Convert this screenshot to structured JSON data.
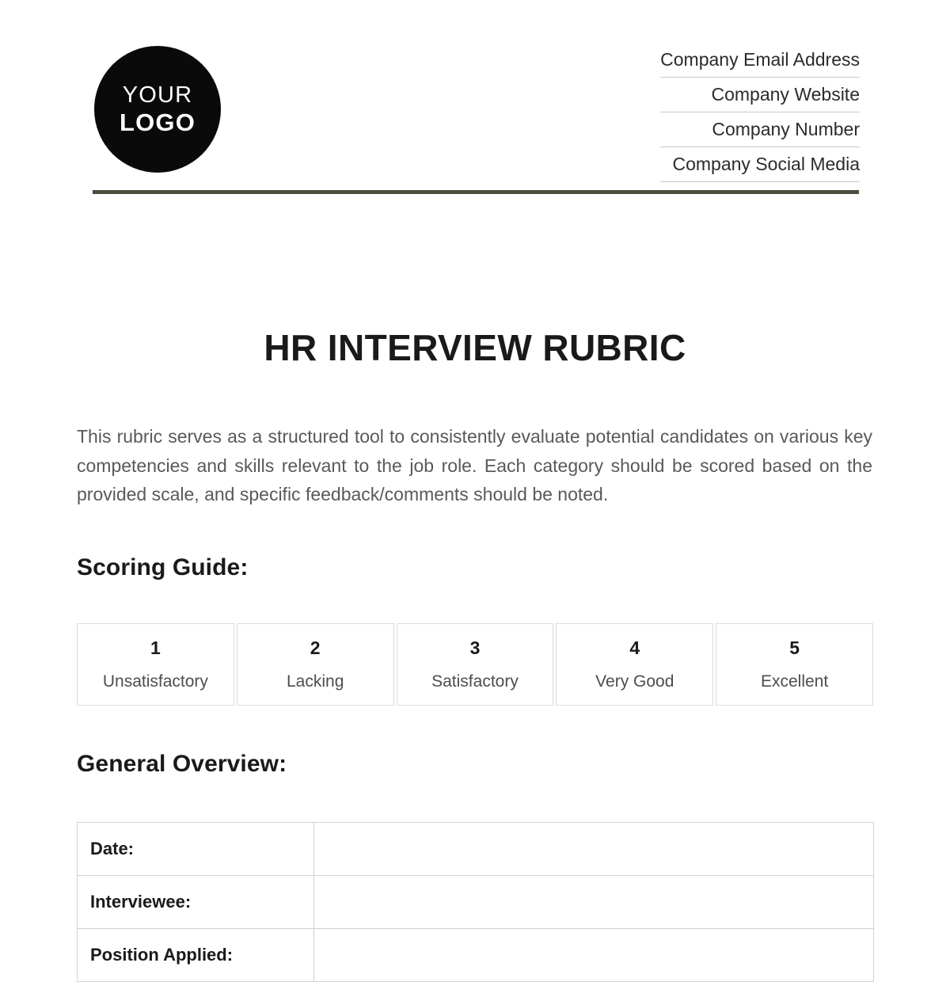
{
  "header": {
    "logo": {
      "line1": "YOUR",
      "line2": "LOGO"
    },
    "contact": [
      {
        "label": "Company Email Address"
      },
      {
        "label": "Company Website"
      },
      {
        "label": "Company Number"
      },
      {
        "label": "Company Social Media"
      }
    ],
    "rule_color": "#4b4b3e"
  },
  "document": {
    "title": "HR INTERVIEW RUBRIC",
    "intro": "This rubric serves as a structured tool to consistently evaluate potential candidates on various key competencies and skills relevant to the job role. Each category should be scored based on the provided scale, and specific feedback/comments should be noted."
  },
  "scoring_guide": {
    "heading": "Scoring Guide:",
    "scale": [
      {
        "score": "1",
        "label": "Unsatisfactory"
      },
      {
        "score": "2",
        "label": "Lacking"
      },
      {
        "score": "3",
        "label": "Satisfactory"
      },
      {
        "score": "4",
        "label": "Very Good"
      },
      {
        "score": "5",
        "label": "Excellent"
      }
    ]
  },
  "general_overview": {
    "heading": "General Overview:",
    "rows": [
      {
        "label": "Date:",
        "value": ""
      },
      {
        "label": "Interviewee:",
        "value": ""
      },
      {
        "label": "Position Applied:",
        "value": ""
      }
    ]
  }
}
